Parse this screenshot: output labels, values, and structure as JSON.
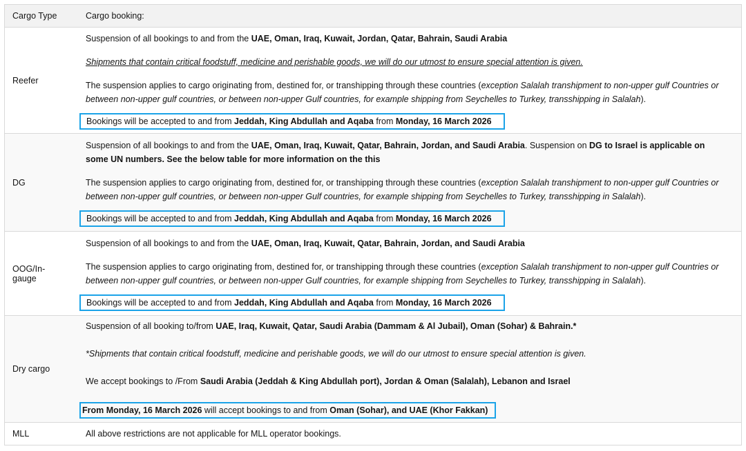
{
  "header": {
    "cargo_type": "Cargo Type",
    "cargo_booking": "Cargo booking:"
  },
  "accent_color": "#1aa3e8",
  "rows": {
    "reefer": {
      "type": "Reefer",
      "p1_pre": "Suspension of all bookings to and from the ",
      "p1_bold": "UAE, Oman, Iraq, Kuwait, Jordan, Qatar, Bahrain, Saudi Arabia",
      "p2": "Shipments that contain critical foodstuff, medicine and perishable goods, we will do our utmost to ensure special attention is given.",
      "p3_pre": "The suspension applies to cargo originating from, destined for, or transhipping through these countries (",
      "p3_it": "exception Salalah transhipment to non-upper gulf Countries or between non-upper gulf countries, or between non-upper Gulf countries, for example shipping from Seychelles to Turkey, transshipping in Salalah",
      "p3_post": ").",
      "box_pre": "Bookings will be accepted to and from ",
      "box_bold1": "Jeddah, King Abdullah and Aqaba",
      "box_mid": " from ",
      "box_bold2": "Monday, 16 March 2026"
    },
    "dg": {
      "type": "DG",
      "p1_pre": "Suspension of all bookings to and from the ",
      "p1_bold": "UAE, Oman, Iraq, Kuwait, Qatar, Bahrain, Jordan, and Saudi Arabia",
      "p1_mid": ". Suspension on ",
      "p1_bold2": "DG to Israel is applicable on some UN numbers. See the below table for more information on the this",
      "p3_pre": "The suspension applies to cargo originating from, destined for, or transhipping through these countries (",
      "p3_it": "exception Salalah transhipment to non-upper gulf Countries or between non-upper gulf countries, or between non-upper Gulf countries, for example shipping from Seychelles to Turkey, transshipping in Salalah",
      "p3_post": ").",
      "box_pre": "Bookings will be accepted to and from ",
      "box_bold1": "Jeddah, King Abdullah and Aqaba",
      "box_mid": " from ",
      "box_bold2": "Monday, 16 March 2026"
    },
    "oog": {
      "type": "OOG/In-gauge",
      "p1_pre": "Suspension of all bookings to and from the ",
      "p1_bold": "UAE, Oman, Iraq, Kuwait, Qatar, Bahrain, Jordan, and Saudi Arabia",
      "p3_pre": "The suspension applies to cargo originating from, destined for, or transhipping through these countries (",
      "p3_it": "exception Salalah transhipment to non-upper gulf Countries or between non-upper gulf countries, or between non-upper Gulf countries, for example shipping from Seychelles to Turkey, transshipping in Salalah",
      "p3_post": ").",
      "box_pre": "Bookings will be accepted to and from ",
      "box_bold1": "Jeddah, King Abdullah and Aqaba",
      "box_mid": " from ",
      "box_bold2": "Monday, 16 March 2026"
    },
    "dry": {
      "type": "Dry cargo",
      "p1_pre": "Suspension of all booking to/from ",
      "p1_bold": "UAE, Iraq, Kuwait, Qatar, Saudi Arabia (Dammam & Al Jubail), Oman (Sohar) & Bahrain.*",
      "p2": "*Shipments that contain critical foodstuff, medicine and perishable goods, we will do our utmost to ensure special attention is given.",
      "p3_pre": "We accept bookings to /From ",
      "p3_bold": "Saudi Arabia (Jeddah & King Abdullah port), Jordan & Oman (Salalah), Lebanon and Israel",
      "box_bold1": "From Monday, 16 March 2026",
      "box_mid": " will accept bookings to and from ",
      "box_bold2": "Oman (Sohar), and UAE (Khor Fakkan)"
    },
    "mll": {
      "type": "MLL",
      "text": "All above restrictions are not applicable for MLL operator bookings."
    }
  }
}
